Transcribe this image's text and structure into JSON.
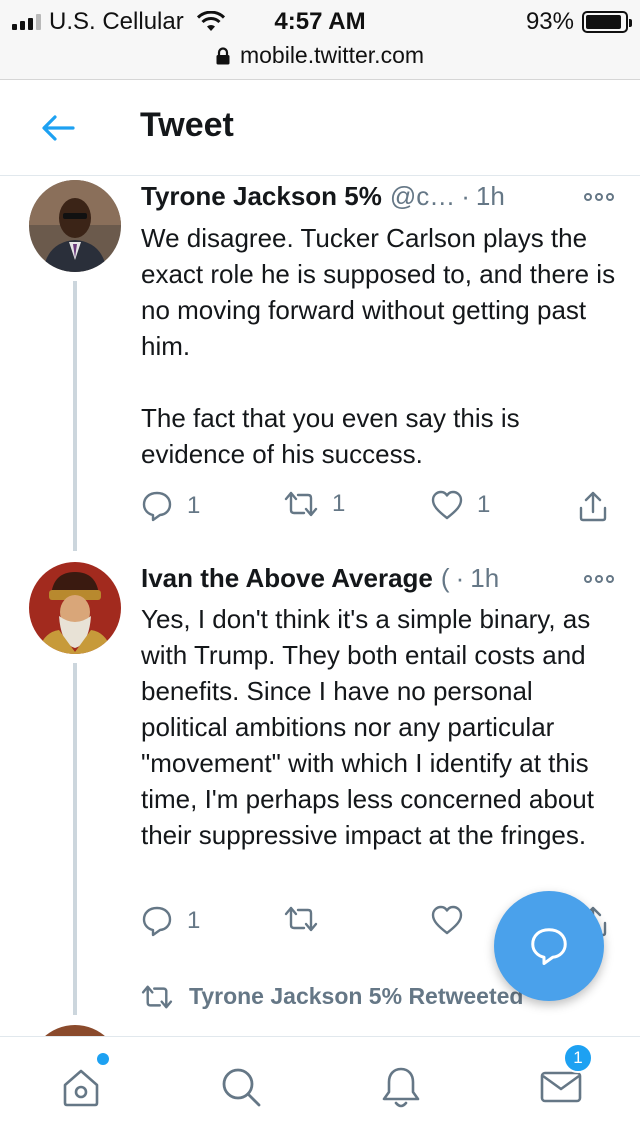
{
  "status_bar": {
    "carrier": "U.S. Cellular",
    "time": "4:57 AM",
    "battery_text": "93%",
    "battery_level": 0.93,
    "url": "mobile.twitter.com"
  },
  "header": {
    "title": "Tweet"
  },
  "tweets": [
    {
      "name": "Tyrone Jackson 5%",
      "handle": "@c…",
      "separator": "·",
      "time": "1h",
      "text": "We disagree. Tucker Carlson plays the exact role he is supposed to, and there is no moving forward without getting past him.\n\nThe fact that you even say this is evidence of his success.",
      "reply_count": "1",
      "retweet_count": "1",
      "like_count": "1"
    },
    {
      "name": "Ivan the Above Average",
      "handle": "(",
      "separator": "·",
      "time": "1h",
      "text": "Yes, I don't think it's a simple binary, as with Trump. They both entail costs and benefits. Since I have no personal political ambitions nor any particular \"movement\" with which I identify at this time, I'm perhaps less concerned about their suppressive impact at the fringes.",
      "reply_count": "1",
      "retweet_count": "",
      "like_count": ""
    }
  ],
  "retweet_note": "Tyrone Jackson 5% Retweeted",
  "nav": {
    "messages_badge": "1"
  },
  "colors": {
    "accent": "#1da1f2",
    "fab": "#4aa1eb",
    "muted": "#657786",
    "thread_line": "#ccd6dd"
  }
}
